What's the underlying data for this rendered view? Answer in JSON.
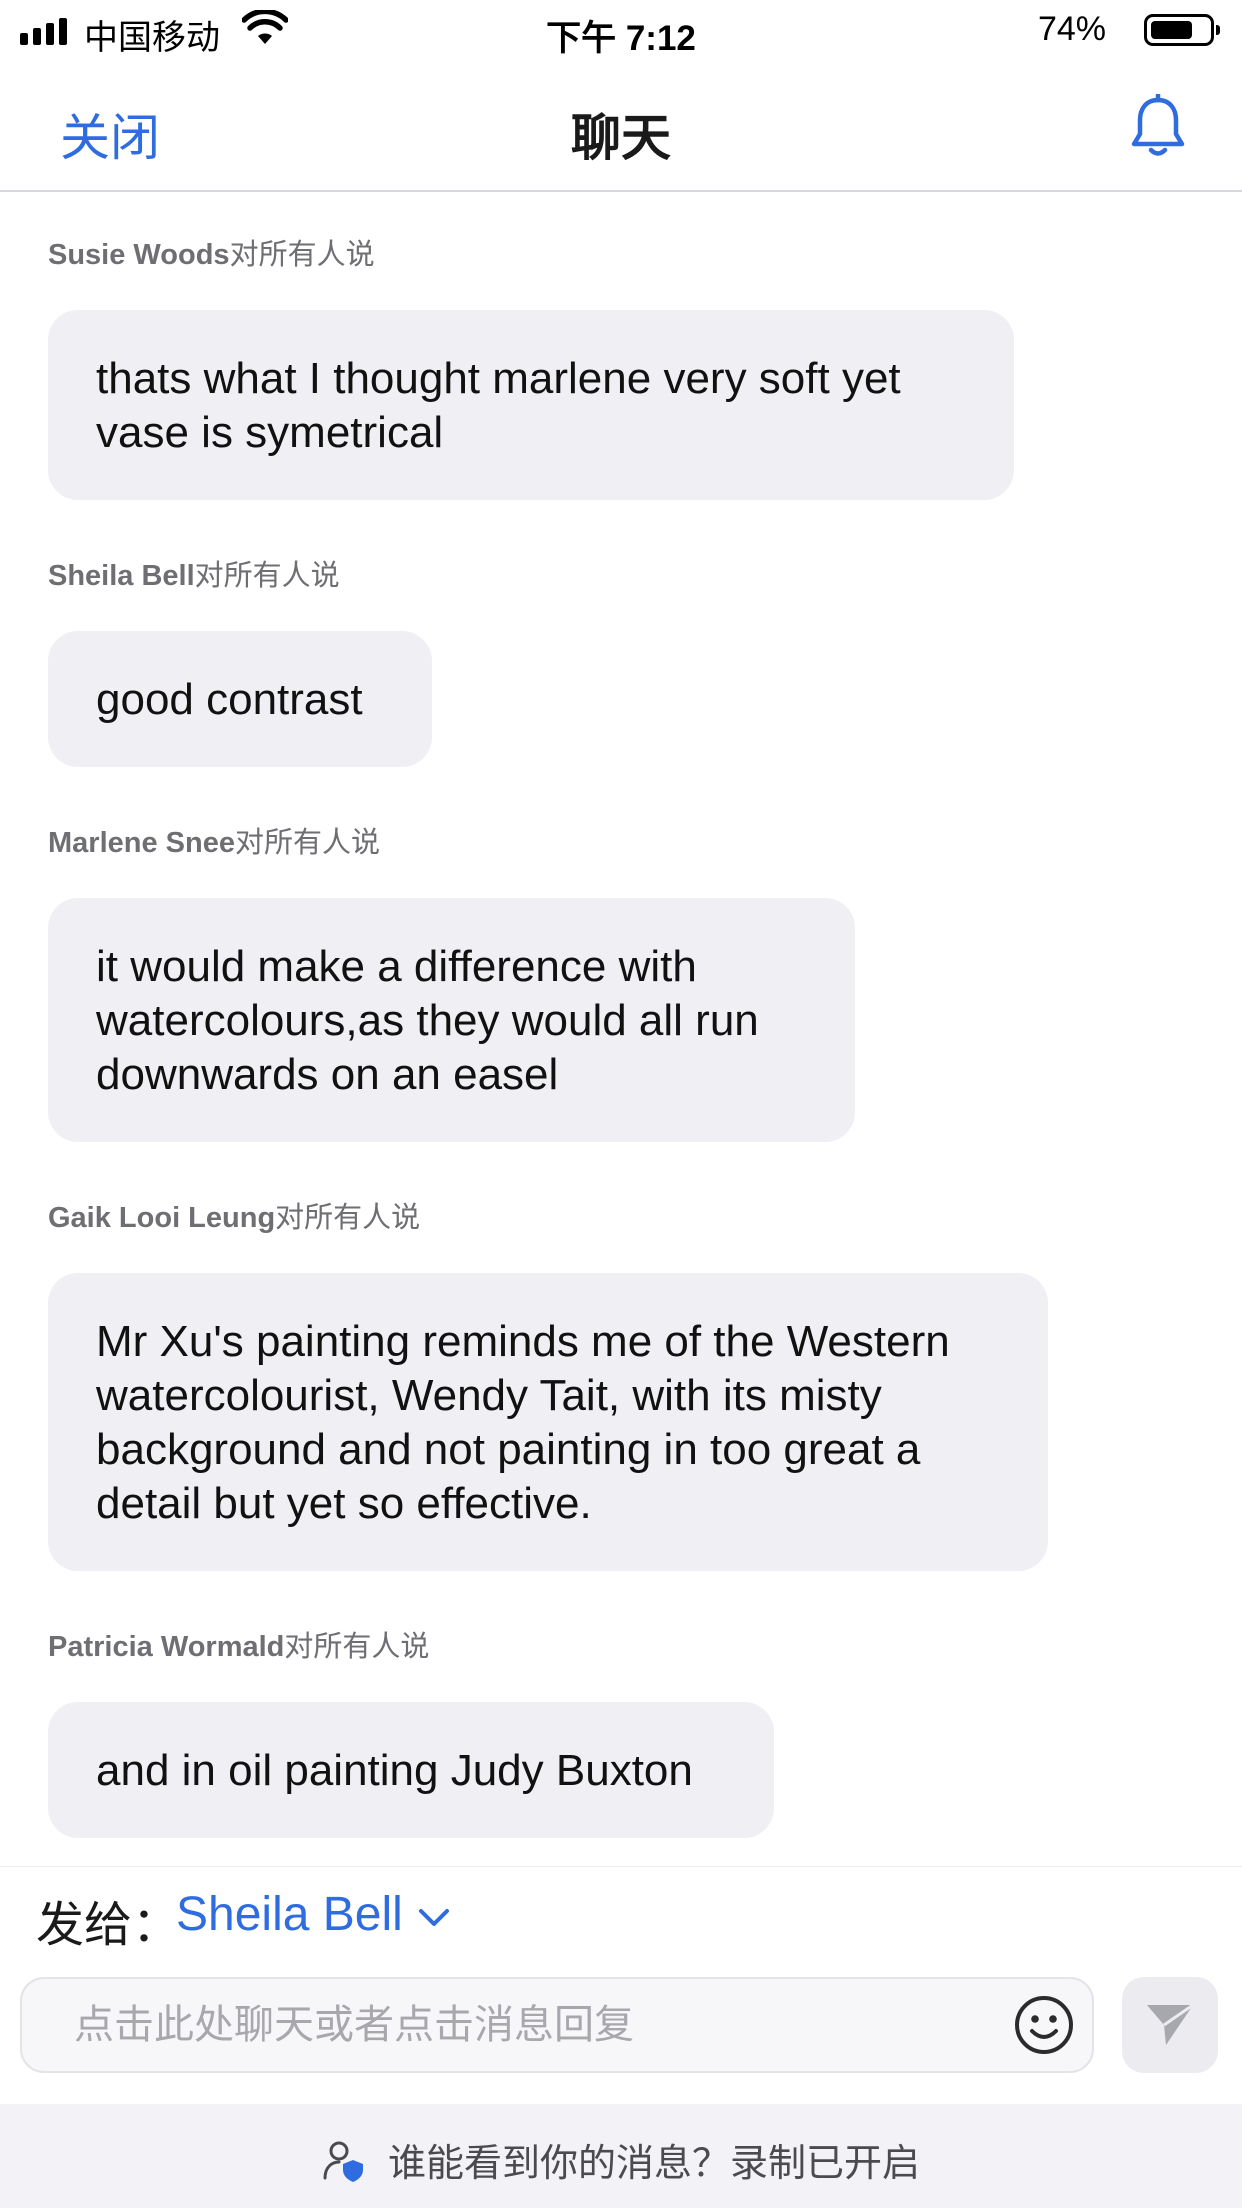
{
  "status": {
    "carrier": "中国移动",
    "time": "下午 7:12",
    "battery": "74%",
    "battery_level": 0.74
  },
  "nav": {
    "close_label": "关闭",
    "title": "聊天"
  },
  "messages": [
    {
      "sender": "Susie Woods",
      "suffix": "对所有人说",
      "text": "thats what I thought marlene very soft yet vase is symetrical"
    },
    {
      "sender": "Sheila Bell",
      "suffix": "对所有人说",
      "text": "good contrast"
    },
    {
      "sender": "Marlene Snee",
      "suffix": "对所有人说",
      "text": "it would make a difference with watercolours,as they would all run downwards on an easel"
    },
    {
      "sender": "Gaik Looi Leung",
      "suffix": "对所有人说",
      "text": "Mr Xu's painting reminds me of the Western watercolourist, Wendy Tait, with its misty background and not painting in too great a detail but yet so effective."
    },
    {
      "sender": "Patricia Wormald",
      "suffix": "对所有人说",
      "text": "and in oil painting Judy Buxton"
    }
  ],
  "composer": {
    "send_to_label": "发给：",
    "recipient": "Sheila Bell",
    "placeholder": "点击此处聊天或者点击消息回复"
  },
  "footer": {
    "text": "谁能看到你的消息？录制已开启"
  },
  "colors": {
    "accent": "#2f6ce0",
    "bubble": "#efeff4",
    "secondary_text": "#6e6e73"
  }
}
